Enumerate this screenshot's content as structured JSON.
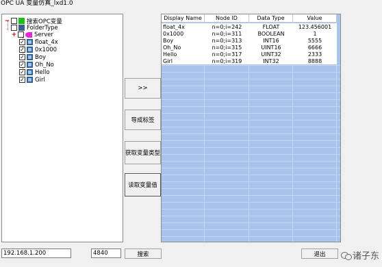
{
  "window": {
    "title": "OPC UA 变量仿真_lxd1.0"
  },
  "tree": {
    "root_label": "搜索OPC变量",
    "folder_label": "FolderType",
    "server_label": "Server",
    "items": [
      "float_4x",
      "0x1000",
      "Boy",
      "Oh_No",
      "Hello",
      "Girl"
    ],
    "checkmark": "✓",
    "expand_symbol": "−",
    "collapse_symbol": "+"
  },
  "buttons": {
    "forward": ">>",
    "export_tags": "导成标签",
    "get_types": "获取变量类型",
    "read_values": "读取变量值",
    "search": "搜索",
    "exit": "退出"
  },
  "grid": {
    "columns": [
      "Display Name",
      "Node ID",
      "Data Type",
      "Value"
    ],
    "rows": [
      [
        "float_4x",
        "n=0;i=242",
        "FLOAT",
        "123.456001"
      ],
      [
        "0x1000",
        "n=0;i=311",
        "BOOLEAN",
        "1"
      ],
      [
        "Boy",
        "n=0;i=313",
        "INT16",
        "5555"
      ],
      [
        "Oh_No",
        "n=0;i=315",
        "UINT16",
        "6666"
      ],
      [
        "Hello",
        "n=0;i=317",
        "UINT32",
        "2333"
      ],
      [
        "Girl",
        "n=0;i=319",
        "INT32",
        "8888"
      ]
    ]
  },
  "inputs": {
    "ip": "192.168.1.200",
    "port": "4840"
  },
  "watermark": {
    "text": "诸子东",
    "icon": "wechat-icon"
  },
  "colors": {
    "grid_bg": "#a9c4ec",
    "root_icon": "#19c119",
    "server_icon": "#e22bd6"
  }
}
